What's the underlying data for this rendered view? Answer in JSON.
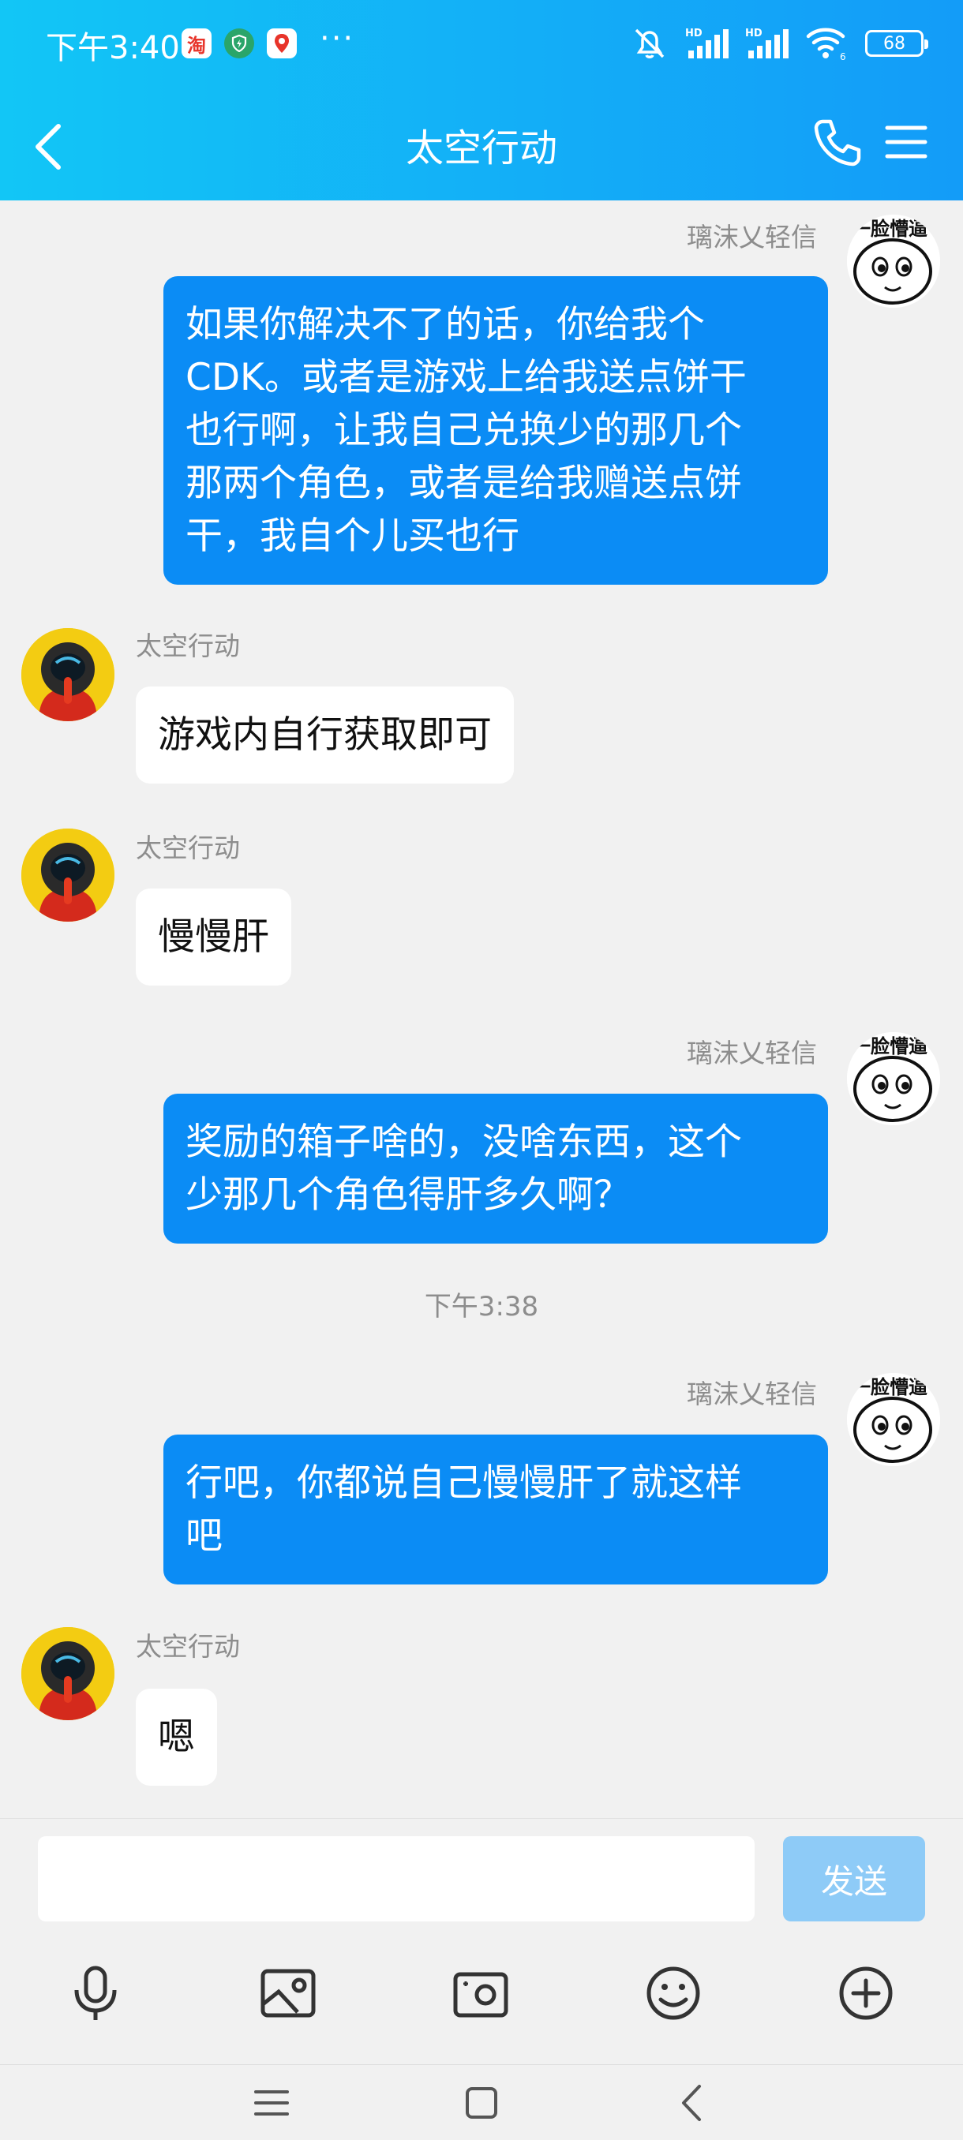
{
  "status_bar": {
    "time": "下午3:40",
    "notifications": [
      "taobao-icon",
      "shield-icon",
      "map-pin-icon"
    ],
    "more": "···",
    "signal_badges": [
      "HD",
      "HD"
    ],
    "wifi_badge": "6",
    "battery": "68"
  },
  "header": {
    "title": "太空行动",
    "back_icon": "chevron-left-icon",
    "call_icon": "phone-icon",
    "menu_icon": "menu-icon"
  },
  "self_name": "璃沫乂轻信",
  "other_name": "太空行动",
  "self_avatar_text": "一脸懵逼",
  "messages": [
    {
      "side": "out",
      "name": "璃沫乂轻信",
      "lines": [
        "如果你解决不了的话，你给我个",
        "CDK。或者是游戏上给我送点饼干",
        "也行啊，让我自己兑换少的那几个",
        "那两个角色，或者是给我赠送点饼",
        "干，我自个儿买也行"
      ]
    },
    {
      "side": "in",
      "name": "太空行动",
      "lines": [
        "游戏内自行获取即可"
      ]
    },
    {
      "side": "in",
      "name": "太空行动",
      "lines": [
        "慢慢肝"
      ]
    },
    {
      "side": "out",
      "name": "璃沫乂轻信",
      "lines": [
        "奖励的箱子啥的，没啥东西，这个",
        "少那几个角色得肝多久啊？"
      ]
    },
    {
      "side": "time",
      "text": "下午3:38"
    },
    {
      "side": "out",
      "name": "璃沫乂轻信",
      "lines": [
        "行吧，你都说自己慢慢肝了就这样",
        "吧"
      ]
    },
    {
      "side": "in",
      "name": "太空行动",
      "lines": [
        "嗯"
      ]
    }
  ],
  "input": {
    "value": "",
    "placeholder": "",
    "send_label": "发送"
  },
  "toolbar": [
    "microphone-icon",
    "image-icon",
    "camera-icon",
    "emoji-icon",
    "plus-icon"
  ],
  "nav": [
    "menu-icon",
    "home-icon",
    "back-icon"
  ],
  "colors": {
    "header_start": "#12c6f6",
    "header_end": "#139cf8",
    "bubble_out": "#0b8cf5",
    "send_disabled": "#8ecbf7",
    "background": "#f1f1f1"
  }
}
